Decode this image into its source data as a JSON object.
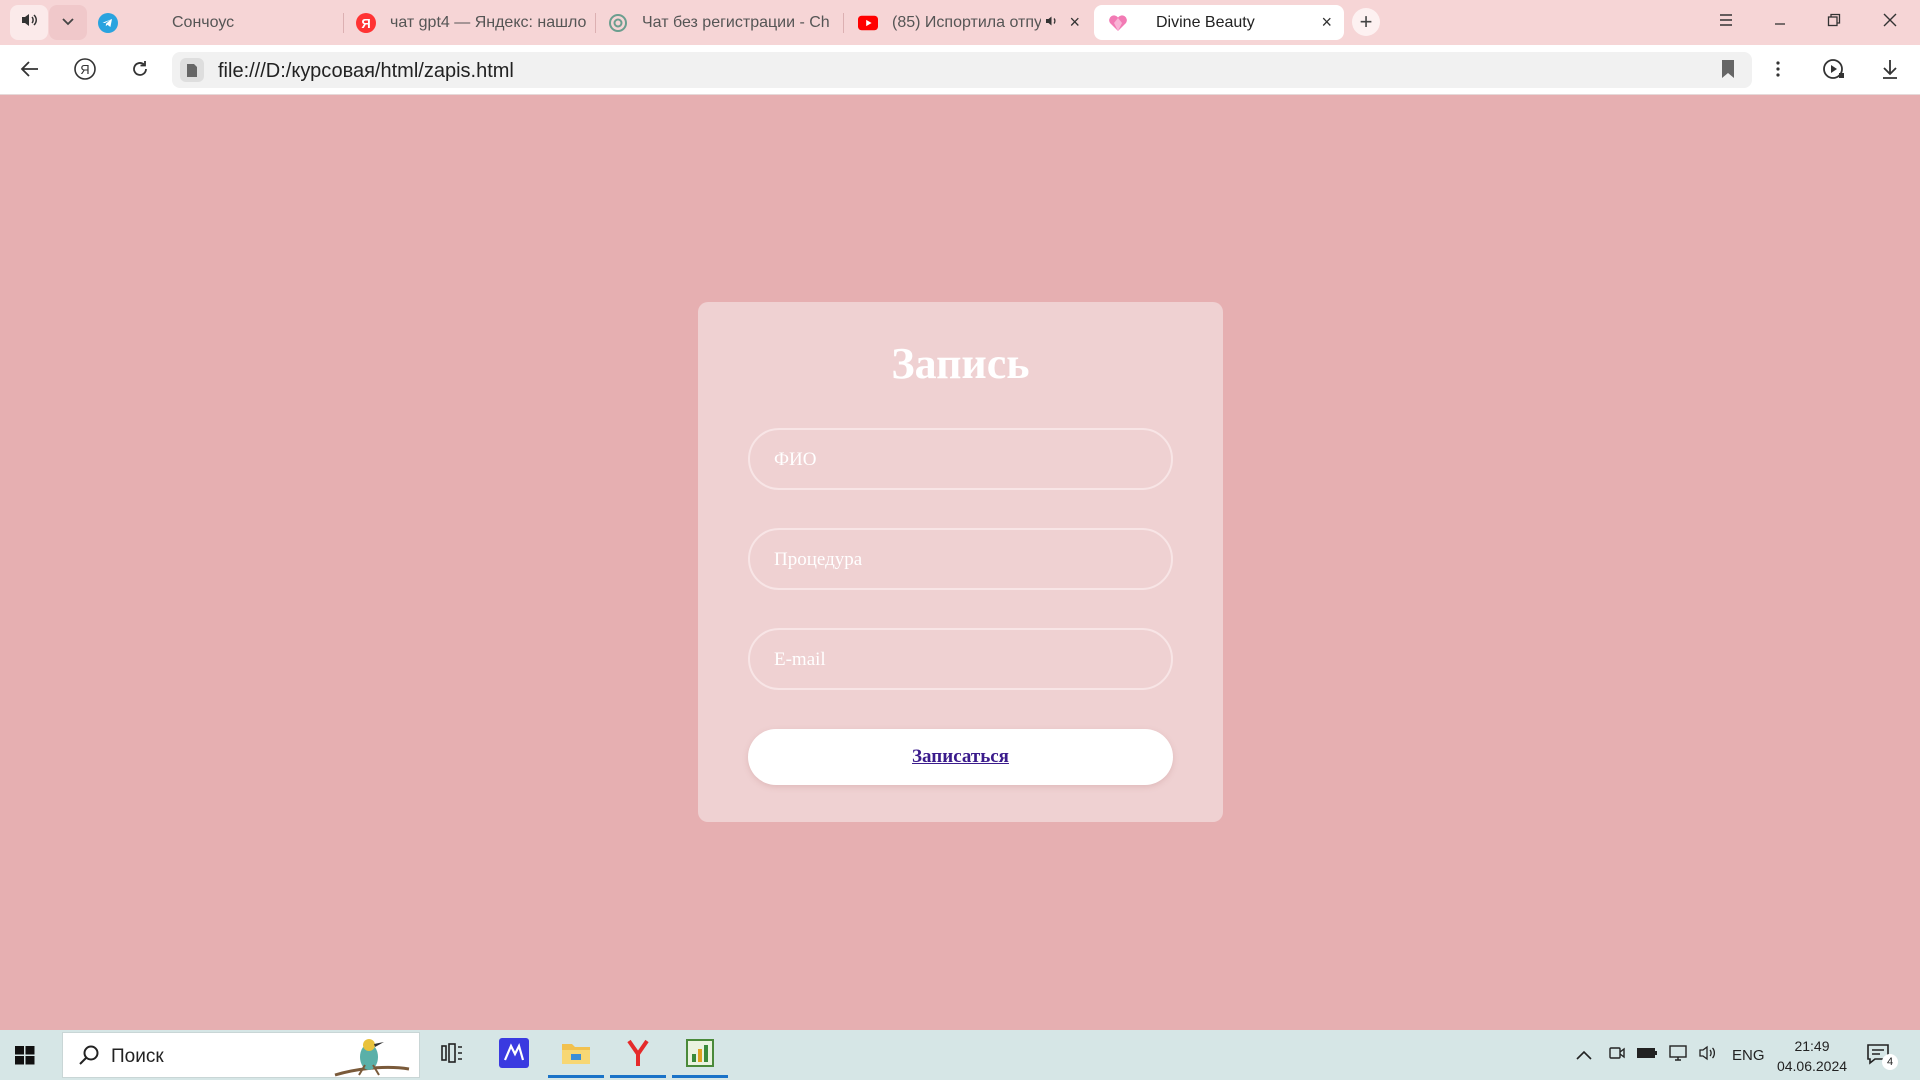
{
  "browser": {
    "tabs": [
      {
        "title": "Сончоус",
        "favicon": "telegram-icon"
      },
      {
        "title": "чат gpt4 — Яндекс: нашло",
        "favicon": "yandex-icon"
      },
      {
        "title": "Чат без регистрации - Ch",
        "favicon": "chatgpt-icon"
      },
      {
        "title": "(85) Испортила отпу",
        "favicon": "youtube-icon"
      },
      {
        "title": "Divine Beauty",
        "favicon": "heart-icon",
        "active": true
      }
    ],
    "url": "file:///D:/курсовая/html/zapis.html"
  },
  "form": {
    "title": "Запись",
    "fields": [
      {
        "placeholder": "ФИО"
      },
      {
        "placeholder": "Процедура"
      },
      {
        "placeholder": "E-mail"
      }
    ],
    "submit_label": "Записаться"
  },
  "taskbar": {
    "search_label": "Поиск",
    "language": "ENG",
    "time": "21:49",
    "date": "04.06.2024",
    "notification_count": "4"
  },
  "colors": {
    "page_background": "#e6afb1",
    "card_background": "#efd1d2",
    "button_text": "#3b1b8c",
    "tabstrip": "#f6d5d6",
    "taskbar": "#d6e6e6"
  }
}
